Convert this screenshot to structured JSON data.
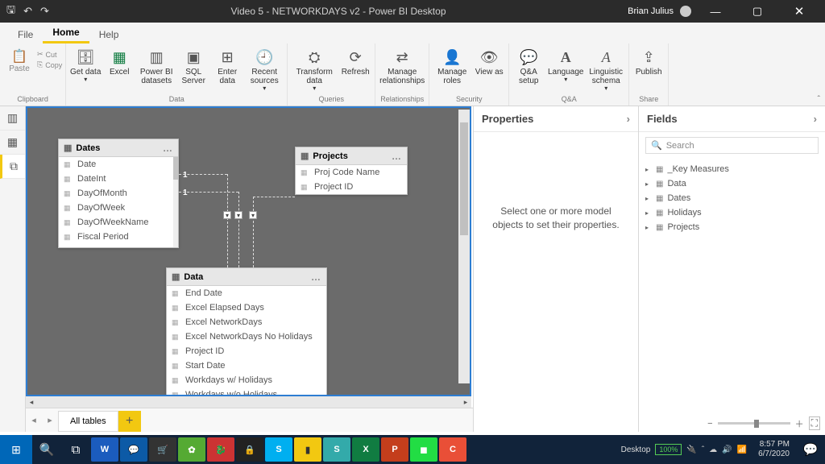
{
  "titlebar": {
    "title": "Video 5 - NETWORKDAYS v2 - Power BI Desktop",
    "user": "Brian Julius"
  },
  "menus": {
    "file": "File",
    "home": "Home",
    "help": "Help"
  },
  "ribbon": {
    "clipboard": {
      "paste": "Paste",
      "cut": "Cut",
      "copy": "Copy",
      "label": "Clipboard"
    },
    "data": {
      "get": "Get\ndata",
      "excel": "Excel",
      "pbids": "Power BI\ndatasets",
      "sql": "SQL\nServer",
      "enter": "Enter\ndata",
      "recent": "Recent\nsources",
      "label": "Data"
    },
    "queries": {
      "transform": "Transform\ndata",
      "refresh": "Refresh",
      "label": "Queries"
    },
    "rel": {
      "manage": "Manage\nrelationships",
      "label": "Relationships"
    },
    "security": {
      "roles": "Manage\nroles",
      "viewas": "View\nas",
      "label": "Security"
    },
    "qa": {
      "setup": "Q&A\nsetup",
      "lang": "Language",
      "ling": "Linguistic\nschema",
      "label": "Q&A"
    },
    "share": {
      "publish": "Publish",
      "label": "Share"
    }
  },
  "tables": {
    "dates": {
      "name": "Dates",
      "fields": [
        "Date",
        "DateInt",
        "DayOfMonth",
        "DayOfWeek",
        "DayOfWeekName",
        "Fiscal Period"
      ]
    },
    "projects": {
      "name": "Projects",
      "fields": [
        "Proj Code Name",
        "Project ID"
      ]
    },
    "data": {
      "name": "Data",
      "fields": [
        "End Date",
        "Excel Elapsed Days",
        "Excel NetworkDays",
        "Excel NetworkDays No Holidays",
        "Project ID",
        "Start Date",
        "Workdays w/ Holidays",
        "Workdays w/o Holidays"
      ]
    }
  },
  "rel_labels": {
    "one_a": "1",
    "one_b": "1"
  },
  "pager": {
    "all": "All tables"
  },
  "properties": {
    "title": "Properties",
    "empty": "Select one or more model objects to set their properties."
  },
  "fields_panel": {
    "title": "Fields",
    "search_placeholder": "Search",
    "nodes": [
      "_Key Measures",
      "Data",
      "Dates",
      "Holidays",
      "Projects"
    ]
  },
  "taskbar": {
    "desktop": "Desktop",
    "battery": "100%",
    "time": "8:57 PM",
    "date": "6/7/2020"
  }
}
